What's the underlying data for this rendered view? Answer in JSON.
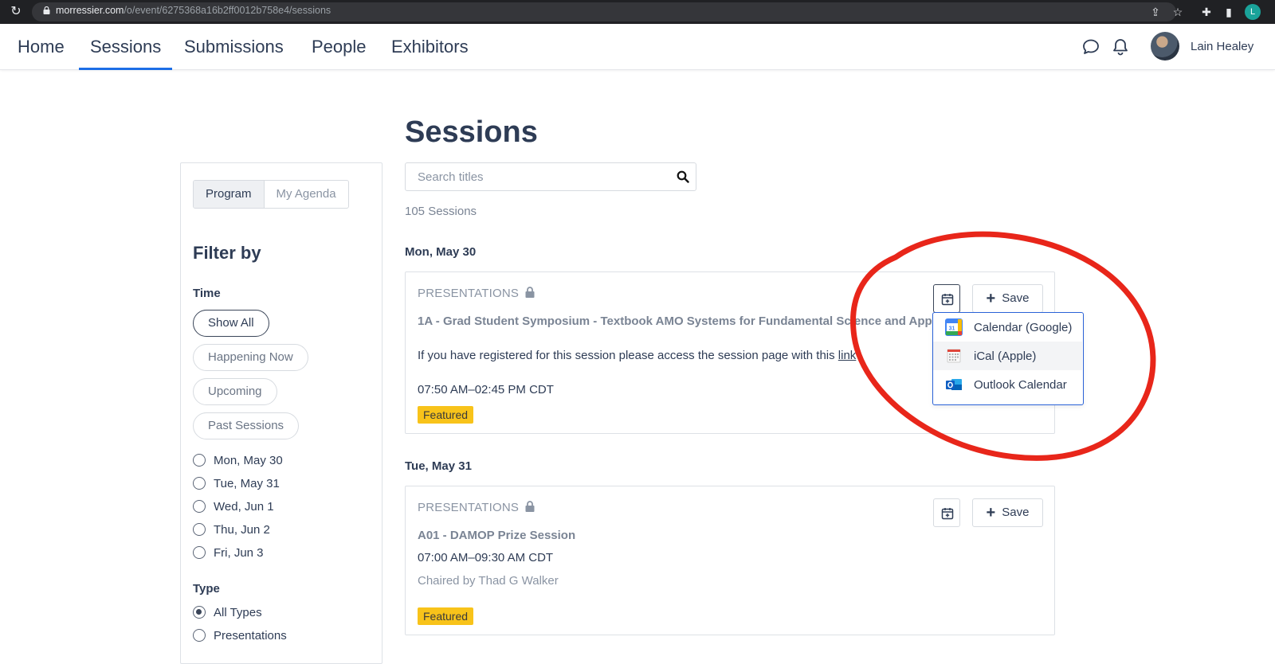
{
  "browser": {
    "url_domain": "morressier.com",
    "url_path": "/o/event/6275368a16b2ff0012b758e4/sessions",
    "profile_initial": "L"
  },
  "nav": {
    "tabs": [
      {
        "label": "Home"
      },
      {
        "label": "Sessions"
      },
      {
        "label": "Submissions"
      },
      {
        "label": "People"
      },
      {
        "label": "Exhibitors"
      }
    ],
    "active_tab": "Sessions",
    "user_name": "Lain Healey"
  },
  "sidebar": {
    "segments": [
      "Program",
      "My Agenda"
    ],
    "selected_segment": "Program",
    "filter_title": "Filter by",
    "time_label": "Time",
    "time_pills": [
      "Show All",
      "Happening Now",
      "Upcoming",
      "Past Sessions"
    ],
    "selected_time": "Show All",
    "days": [
      "Mon, May 30",
      "Tue, May 31",
      "Wed, Jun 1",
      "Thu, Jun 2",
      "Fri, Jun 3"
    ],
    "type_label": "Type",
    "types": [
      "All Types",
      "Presentations"
    ],
    "selected_type": "All Types"
  },
  "main": {
    "title": "Sessions",
    "search_placeholder": "Search titles",
    "count": "105 Sessions",
    "days": [
      {
        "label": "Mon, May 30",
        "session": {
          "type": "PRESENTATIONS",
          "title": "1A - Grad Student Symposium - Textbook AMO Systems for Fundamental Science and Applications",
          "body": "If you have registered for this session please access the session page with this ",
          "link": "link",
          "time": "07:50 AM–02:45 PM CDT",
          "badge": "Featured",
          "save_label": "Save"
        }
      },
      {
        "label": "Tue, May 31",
        "session": {
          "type": "PRESENTATIONS",
          "title": "A01 - DAMOP Prize Session",
          "time": "07:00 AM–09:30 AM CDT",
          "chair": "Chaired by Thad G Walker",
          "badge": "Featured",
          "save_label": "Save"
        }
      }
    ]
  },
  "calendar_menu": {
    "items": [
      {
        "label": "Calendar (Google)",
        "icon": "google-calendar-icon"
      },
      {
        "label": "iCal (Apple)",
        "icon": "ical-icon"
      },
      {
        "label": "Outlook Calendar",
        "icon": "outlook-icon"
      }
    ],
    "hovered": "iCal (Apple)"
  },
  "colors": {
    "accent": "#1d6ee6",
    "badge": "#f8c31a",
    "dropdown_border": "#2a62d8",
    "annotation": "#e8261a"
  }
}
